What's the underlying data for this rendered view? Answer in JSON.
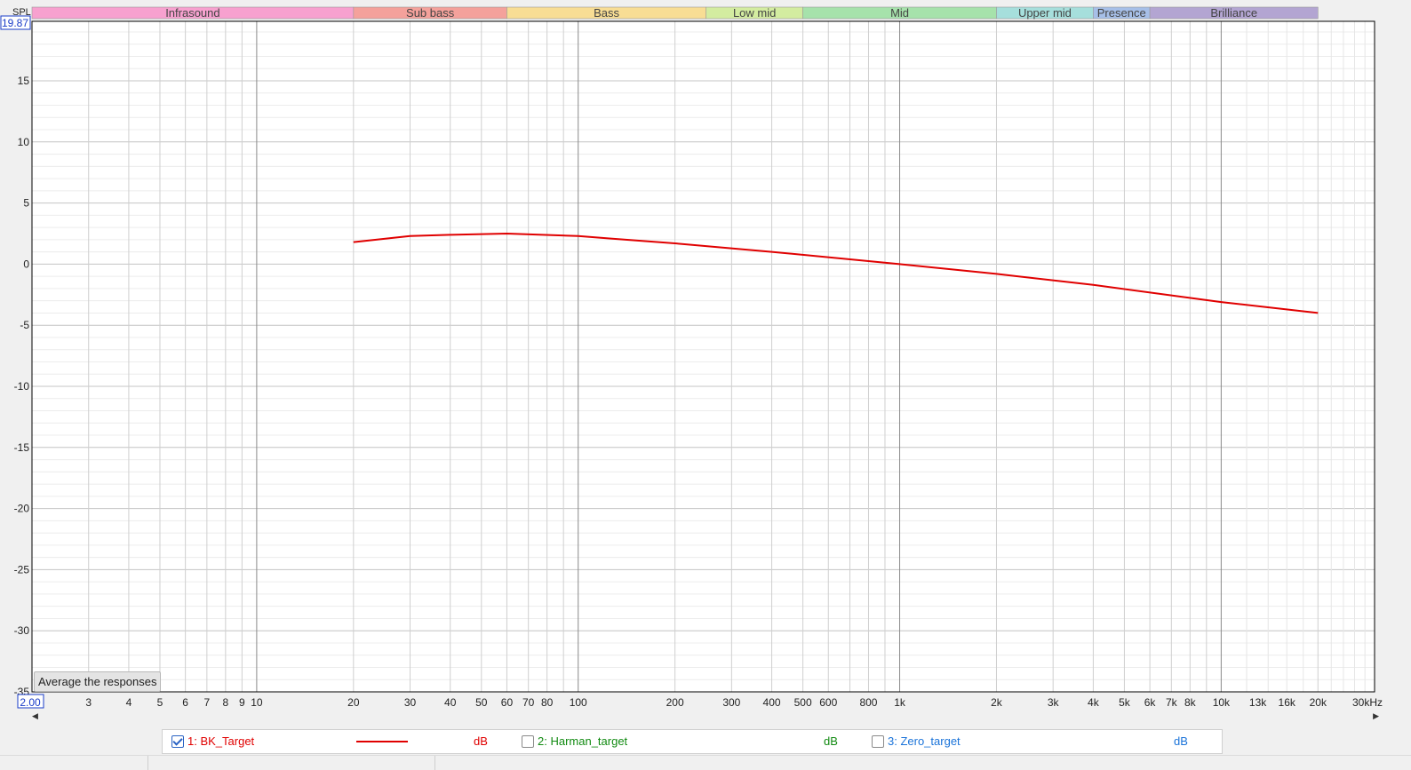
{
  "y_axis": {
    "title": "SPL",
    "top_value": "19.87"
  },
  "x_axis": {
    "left_value": "2.00"
  },
  "bands": [
    {
      "label": "Infrasound",
      "from": 2,
      "to": 20,
      "color": "#f7a1cf"
    },
    {
      "label": "Sub bass",
      "from": 20,
      "to": 60,
      "color": "#f4a19b"
    },
    {
      "label": "Bass",
      "from": 60,
      "to": 250,
      "color": "#f8dd94"
    },
    {
      "label": "Low mid",
      "from": 250,
      "to": 500,
      "color": "#d3eca0"
    },
    {
      "label": "Mid",
      "from": 500,
      "to": 2000,
      "color": "#a6e2ab"
    },
    {
      "label": "Upper mid",
      "from": 2000,
      "to": 4000,
      "color": "#a6dfdc"
    },
    {
      "label": "Presence",
      "from": 4000,
      "to": 6000,
      "color": "#a6bfe8"
    },
    {
      "label": "Brilliance",
      "from": 6000,
      "to": 20000,
      "color": "#b3a5d2"
    }
  ],
  "controls": {
    "average_label": "Average the responses"
  },
  "legend": [
    {
      "name": "1: BK_Target",
      "unit": "dB",
      "color": "#e00000",
      "checked": true,
      "show_swatch": true
    },
    {
      "name": "2: Harman_target",
      "unit": "dB",
      "color": "#118a11",
      "checked": false,
      "show_swatch": false
    },
    {
      "name": "3: Zero_target",
      "unit": "dB",
      "color": "#1a73d9",
      "checked": false,
      "show_swatch": false
    }
  ],
  "chart_data": {
    "type": "line",
    "x_scale": "log",
    "xlim": [
      2,
      30000
    ],
    "ylim": [
      -35,
      19.87
    ],
    "x_unit": "kHz",
    "y_label": "SPL",
    "yticks": [
      "15",
      "10",
      "5",
      "0",
      "-5",
      "-10",
      "-15",
      "-20",
      "-25",
      "-30",
      "-35"
    ],
    "xticks": [
      {
        "v": 3,
        "label": "3",
        "faint": false
      },
      {
        "v": 4,
        "label": "4",
        "faint": false
      },
      {
        "v": 5,
        "label": "5",
        "faint": false
      },
      {
        "v": 6,
        "label": "6",
        "faint": false
      },
      {
        "v": 7,
        "label": "7",
        "faint": false
      },
      {
        "v": 8,
        "label": "8",
        "faint": false
      },
      {
        "v": 9,
        "label": "9",
        "faint": false
      },
      {
        "v": 10,
        "label": "10",
        "faint": false
      },
      {
        "v": 20,
        "label": "20",
        "faint": false
      },
      {
        "v": 30,
        "label": "30",
        "faint": false
      },
      {
        "v": 40,
        "label": "40",
        "faint": false
      },
      {
        "v": 50,
        "label": "50",
        "faint": false
      },
      {
        "v": 60,
        "label": "60",
        "faint": false
      },
      {
        "v": 70,
        "label": "70",
        "faint": false
      },
      {
        "v": 80,
        "label": "80",
        "faint": false
      },
      {
        "v": 100,
        "label": "100",
        "faint": false
      },
      {
        "v": 200,
        "label": "200",
        "faint": false
      },
      {
        "v": 300,
        "label": "300",
        "faint": false
      },
      {
        "v": 400,
        "label": "400",
        "faint": false
      },
      {
        "v": 500,
        "label": "500",
        "faint": false
      },
      {
        "v": 600,
        "label": "600",
        "faint": false
      },
      {
        "v": 800,
        "label": "800",
        "faint": false
      },
      {
        "v": 1000,
        "label": "1k",
        "faint": false
      },
      {
        "v": 2000,
        "label": "2k",
        "faint": false
      },
      {
        "v": 3000,
        "label": "3k",
        "faint": false
      },
      {
        "v": 4000,
        "label": "4k",
        "faint": false
      },
      {
        "v": 5000,
        "label": "5k",
        "faint": false
      },
      {
        "v": 6000,
        "label": "6k",
        "faint": false
      },
      {
        "v": 7000,
        "label": "7k",
        "faint": false
      },
      {
        "v": 8000,
        "label": "8k",
        "faint": false
      },
      {
        "v": 10000,
        "label": "10k",
        "faint": false
      },
      {
        "v": 13000,
        "label": "13k",
        "faint": true
      },
      {
        "v": 16000,
        "label": "16k",
        "faint": true
      },
      {
        "v": 20000,
        "label": "20k",
        "faint": false
      },
      {
        "v": 30000,
        "label": "30kHz",
        "faint": false
      }
    ],
    "series": [
      {
        "name": "1: BK_Target",
        "color": "#e00000",
        "x": [
          20,
          30,
          40,
          60,
          100,
          125,
          200,
          400,
          1000,
          2000,
          4000,
          10000,
          20000
        ],
        "y": [
          1.8,
          2.3,
          2.4,
          2.5,
          2.3,
          2.1,
          1.7,
          1.0,
          0.0,
          -0.8,
          -1.7,
          -3.1,
          -4.0
        ]
      }
    ]
  }
}
